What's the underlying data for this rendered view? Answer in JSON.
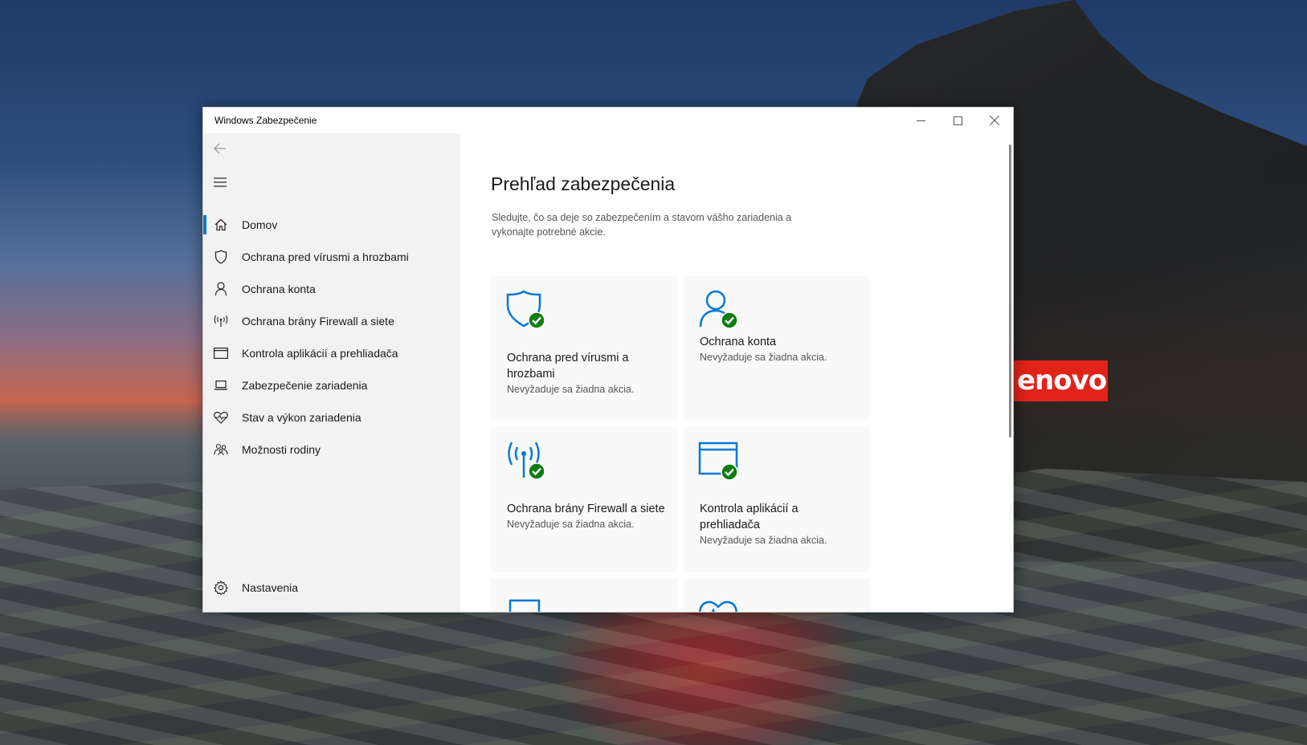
{
  "window": {
    "title": "Windows Zabezpečenie",
    "controls": {
      "minimize_icon": "minimize-icon",
      "maximize_icon": "maximize-icon",
      "close_icon": "close-icon"
    }
  },
  "sidebar": {
    "items": [
      {
        "label": "Domov",
        "icon": "home-icon",
        "active": true
      },
      {
        "label": "Ochrana pred vírusmi a hrozbami",
        "icon": "shield-icon"
      },
      {
        "label": "Ochrana konta",
        "icon": "person-icon"
      },
      {
        "label": "Ochrana brány Firewall a siete",
        "icon": "antenna-icon"
      },
      {
        "label": "Kontrola aplikácií a prehliadača",
        "icon": "browser-window-icon"
      },
      {
        "label": "Zabezpečenie zariadenia",
        "icon": "laptop-icon"
      },
      {
        "label": "Stav a výkon zariadenia",
        "icon": "heart-pulse-icon"
      },
      {
        "label": "Možnosti rodiny",
        "icon": "family-icon"
      }
    ],
    "settings_label": "Nastavenia"
  },
  "main": {
    "title": "Prehľad zabezpečenia",
    "description": "Sledujte, čo sa deje so zabezpečením a stavom vášho zariadenia a vykonajte potrebné akcie.",
    "tiles": [
      {
        "title": "Ochrana pred vírusmi a hrozbami",
        "status": "Nevyžaduje sa žiadna akcia.",
        "icon": "shield-check-icon"
      },
      {
        "title": "Ochrana konta",
        "status": "Nevyžaduje sa žiadna akcia.",
        "icon": "person-check-icon"
      },
      {
        "title": "Ochrana brány Firewall a siete",
        "status": "Nevyžaduje sa žiadna akcia.",
        "icon": "antenna-check-icon"
      },
      {
        "title": "Kontrola aplikácií a prehliadača",
        "status": "Nevyžaduje sa žiadna akcia.",
        "icon": "browser-check-icon"
      }
    ]
  },
  "desktop": {
    "logo_text": "enovo"
  },
  "colors": {
    "accent": "#0078d7",
    "check": "#107c10",
    "sidebar_bg": "#f2f2f2",
    "tile_bg": "#f9f9f9",
    "logo_bg": "#e2231a"
  }
}
